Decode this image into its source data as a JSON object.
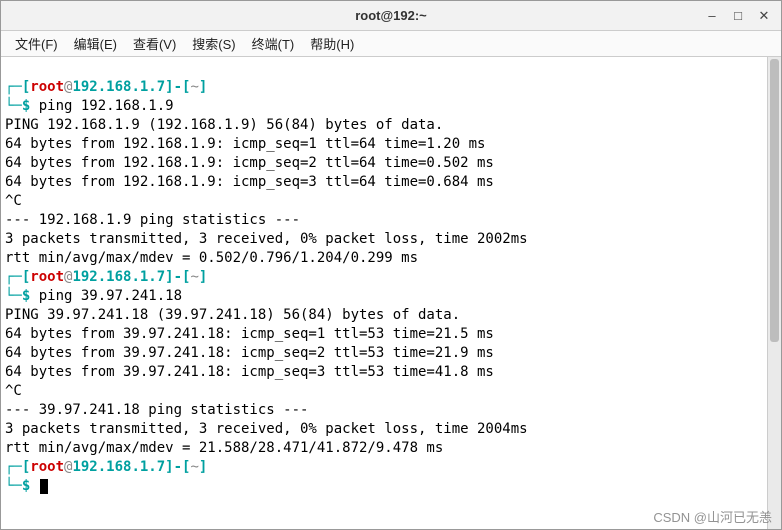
{
  "titlebar": {
    "title": "root@192:~"
  },
  "menu": {
    "file": "文件(F)",
    "edit": "编辑(E)",
    "view": "查看(V)",
    "search": "搜索(S)",
    "terminal": "终端(T)",
    "help": "帮助(H)"
  },
  "prompt": {
    "bracket_open": "┌─[",
    "bracket_close": "]",
    "user": "root",
    "at": "@",
    "host": "192.168.1.7",
    "sep": "-[",
    "tilde": "~",
    "line2_prefix": "└─",
    "dollar": "$"
  },
  "session1": {
    "command": "ping 192.168.1.9",
    "header": "PING 192.168.1.9 (192.168.1.9) 56(84) bytes of data.",
    "l1": "64 bytes from 192.168.1.9: icmp_seq=1 ttl=64 time=1.20 ms",
    "l2": "64 bytes from 192.168.1.9: icmp_seq=2 ttl=64 time=0.502 ms",
    "l3": "64 bytes from 192.168.1.9: icmp_seq=3 ttl=64 time=0.684 ms",
    "break": "^C",
    "stats_hdr": "--- 192.168.1.9 ping statistics ---",
    "stats1": "3 packets transmitted, 3 received, 0% packet loss, time 2002ms",
    "stats2": "rtt min/avg/max/mdev = 0.502/0.796/1.204/0.299 ms"
  },
  "session2": {
    "command": "ping 39.97.241.18",
    "header": "PING 39.97.241.18 (39.97.241.18) 56(84) bytes of data.",
    "l1": "64 bytes from 39.97.241.18: icmp_seq=1 ttl=53 time=21.5 ms",
    "l2": "64 bytes from 39.97.241.18: icmp_seq=2 ttl=53 time=21.9 ms",
    "l3": "64 bytes from 39.97.241.18: icmp_seq=3 ttl=53 time=41.8 ms",
    "break": "^C",
    "stats_hdr": "--- 39.97.241.18 ping statistics ---",
    "stats1": "3 packets transmitted, 3 received, 0% packet loss, time 2004ms",
    "stats2": "rtt min/avg/max/mdev = 21.588/28.471/41.872/9.478 ms"
  },
  "watermark": "CSDN @山河已无恙"
}
